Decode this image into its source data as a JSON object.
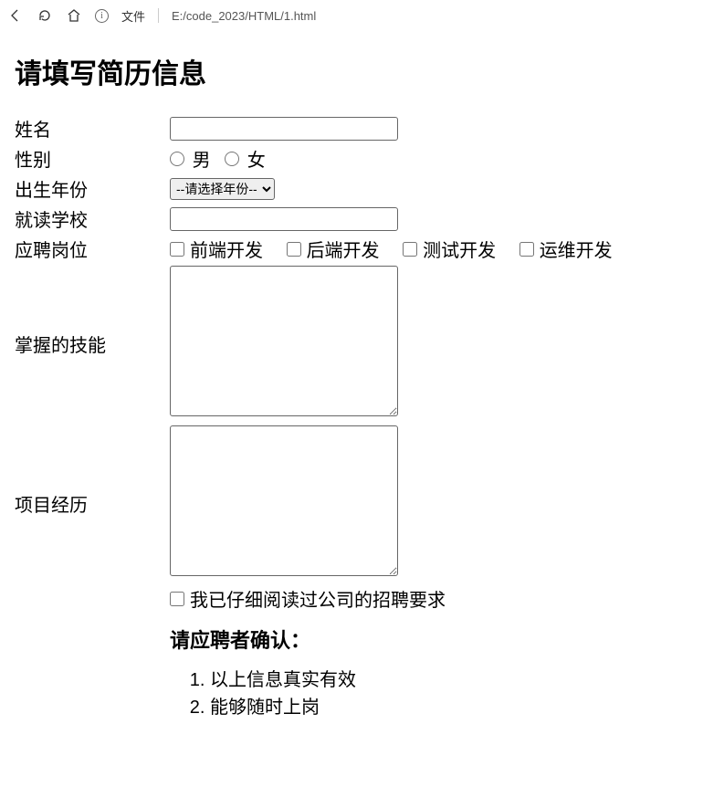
{
  "browser": {
    "file_label": "文件",
    "url": "E:/code_2023/HTML/1.html"
  },
  "page": {
    "title": "请填写简历信息"
  },
  "form": {
    "name": {
      "label": "姓名"
    },
    "gender": {
      "label": "性别",
      "male": "男",
      "female": "女"
    },
    "birth": {
      "label": "出生年份",
      "placeholder": "--请选择年份--"
    },
    "school": {
      "label": "就读学校"
    },
    "position": {
      "label": "应聘岗位",
      "options": {
        "frontend": "前端开发",
        "backend": "后端开发",
        "test": "测试开发",
        "ops": "运维开发"
      }
    },
    "skills": {
      "label": "掌握的技能"
    },
    "projects": {
      "label": "项目经历"
    },
    "agree": {
      "label": "我已仔细阅读过公司的招聘要求"
    },
    "confirm": {
      "title": "请应聘者确认：",
      "items": {
        "0": "以上信息真实有效",
        "1": "能够随时上岗"
      }
    }
  }
}
